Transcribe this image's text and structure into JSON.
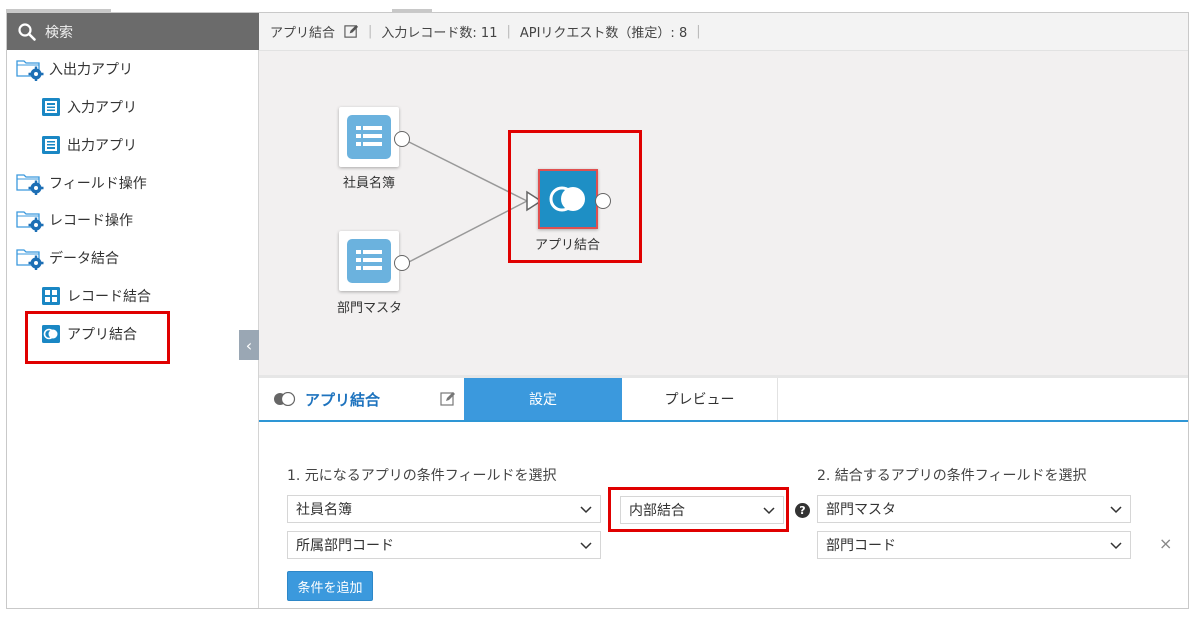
{
  "sidebar": {
    "search_label": "検索",
    "items": [
      {
        "label": "入出力アプリ",
        "type": "folder"
      },
      {
        "label": "入力アプリ",
        "type": "app"
      },
      {
        "label": "出力アプリ",
        "type": "app"
      },
      {
        "label": "フィールド操作",
        "type": "folder"
      },
      {
        "label": "レコード操作",
        "type": "folder"
      },
      {
        "label": "データ結合",
        "type": "folder"
      },
      {
        "label": "レコード結合",
        "type": "app"
      },
      {
        "label": "アプリ結合",
        "type": "app",
        "highlighted": true
      }
    ],
    "collapse_glyph": "‹"
  },
  "main": {
    "title": "アプリ結合",
    "input_records": "入力レコード数: 11",
    "api_requests": "APIリクエスト数（推定）: 8"
  },
  "canvas": {
    "nodes": [
      {
        "label": "社員名簿",
        "icon": "list-icon"
      },
      {
        "label": "部門マスタ",
        "icon": "list-icon"
      },
      {
        "label": "アプリ結合",
        "icon": "toggle-icon",
        "selected": true
      }
    ]
  },
  "panel": {
    "title": "アプリ結合",
    "tabs": [
      {
        "label": "設定",
        "active": true
      },
      {
        "label": "プレビュー",
        "active": false
      }
    ],
    "left_label": "1. 元になるアプリの条件フィールドを選択",
    "right_label": "2. 結合するアプリの条件フィールドを選択",
    "left_app": "社員名簿",
    "left_field": "所属部門コード",
    "join_type": "内部結合",
    "right_app": "部門マスタ",
    "right_field": "部門コード",
    "help_glyph": "?",
    "remove_glyph": "×",
    "add_button": "条件を追加"
  },
  "colors": {
    "accent": "#3b99dd",
    "highlight": "#e00000",
    "node_blue": "#6bb2de",
    "join_node": "#1e8fc5",
    "title_blue": "#1e73be"
  }
}
